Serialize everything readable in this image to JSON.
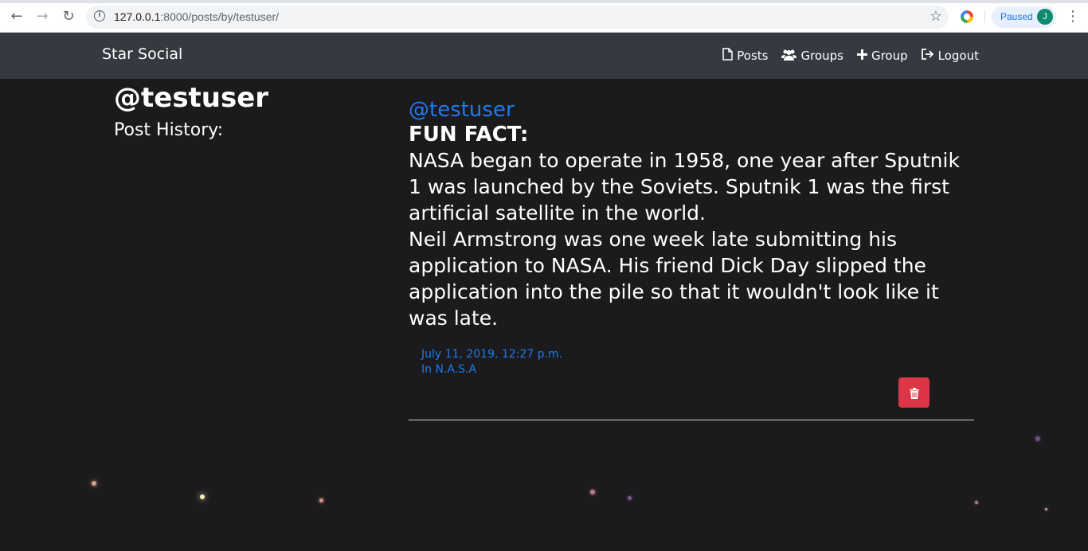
{
  "browser": {
    "url_host": "127.0.0.1",
    "url_rest": ":8000/posts/by/testuser/",
    "profile_status": "Paused",
    "profile_initial": "J"
  },
  "navbar": {
    "brand": "Star Social",
    "links": [
      {
        "label": "Posts",
        "icon": "file-icon"
      },
      {
        "label": "Groups",
        "icon": "users-icon"
      },
      {
        "label": "Group",
        "icon": "plus-icon"
      },
      {
        "label": "Logout",
        "icon": "logout-icon"
      }
    ]
  },
  "profile": {
    "handle": "@testuser",
    "history_label": "Post History:"
  },
  "post": {
    "user": "@testuser",
    "title": "FUN FACT:",
    "paragraph1": "NASA began to operate in 1958, one year after Sputnik 1 was launched by the Soviets. Sputnik 1 was the first artificial satellite in the world.",
    "paragraph2": "Neil Armstrong was one week late submitting his application to NASA. His friend Dick Day slipped the application into the pile so that it wouldn't look like it was late.",
    "timestamp": "July 11, 2019, 12:27 p.m.",
    "group": "In N.A.S.A",
    "delete_icon": "trash-icon"
  },
  "colors": {
    "accent": "#1f7af0",
    "danger": "#dc3545",
    "navbar": "#343a40",
    "background": "#1b1a1c"
  }
}
